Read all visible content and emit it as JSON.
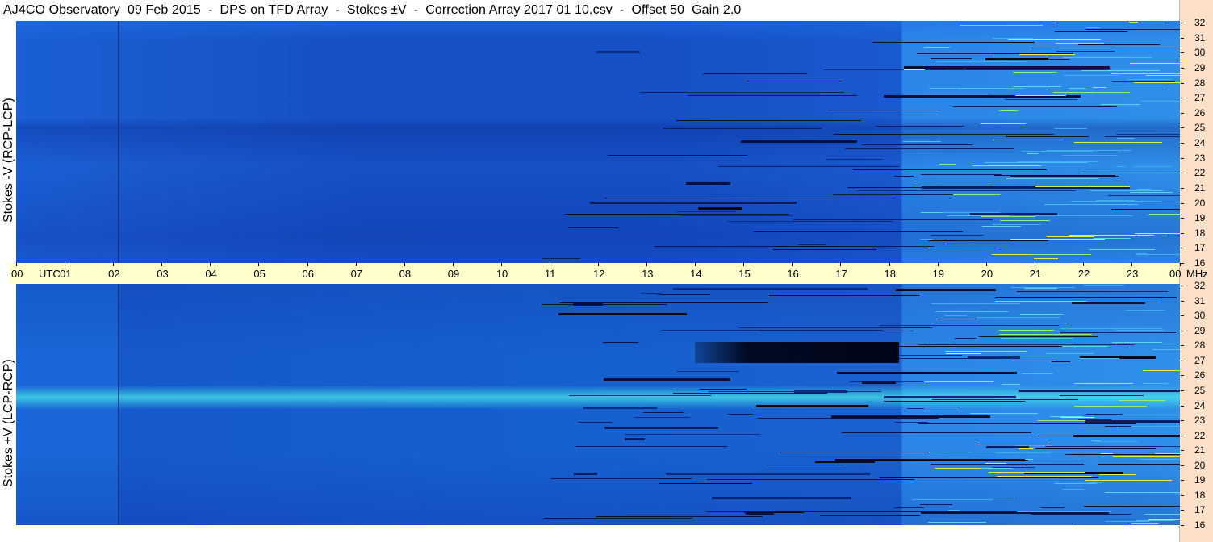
{
  "header": {
    "title": "AJ4CO Observatory  09 Feb 2015  -  DPS on TFD Array  -  Stokes ±V  -  Correction Array 2017 01 10.csv  -  Offset 50  Gain 2.0"
  },
  "chart_data": {
    "type": "heatmap",
    "title": "AJ4CO Observatory  09 Feb 2015  -  DPS on TFD Array  -  Stokes ±V  -  Correction Array 2017 01 10.csv  -  Offset 50  Gain 2.0",
    "x_unit": "UTC",
    "y_unit": "MHz",
    "x_ticks": [
      "00",
      "01",
      "02",
      "03",
      "04",
      "05",
      "06",
      "07",
      "08",
      "09",
      "10",
      "11",
      "12",
      "13",
      "14",
      "15",
      "16",
      "17",
      "18",
      "19",
      "20",
      "21",
      "22",
      "23",
      "00"
    ],
    "y_ticks": [
      "32",
      "31",
      "30",
      "29",
      "28",
      "27",
      "26",
      "25",
      "24",
      "23",
      "22",
      "21",
      "20",
      "19",
      "18",
      "17",
      "16"
    ],
    "xlim_hours": [
      0,
      24
    ],
    "ylim_mhz": [
      16,
      32
    ],
    "panels": [
      {
        "name": "Stokes -V (RCP-LCP)"
      },
      {
        "name": "Stokes +V (LCP-RCP)"
      }
    ],
    "colormap": [
      "#000000",
      "#0d2fa0",
      "#1a5bd0",
      "#2f90ea",
      "#5fe0e0",
      "#e8e84a"
    ]
  }
}
